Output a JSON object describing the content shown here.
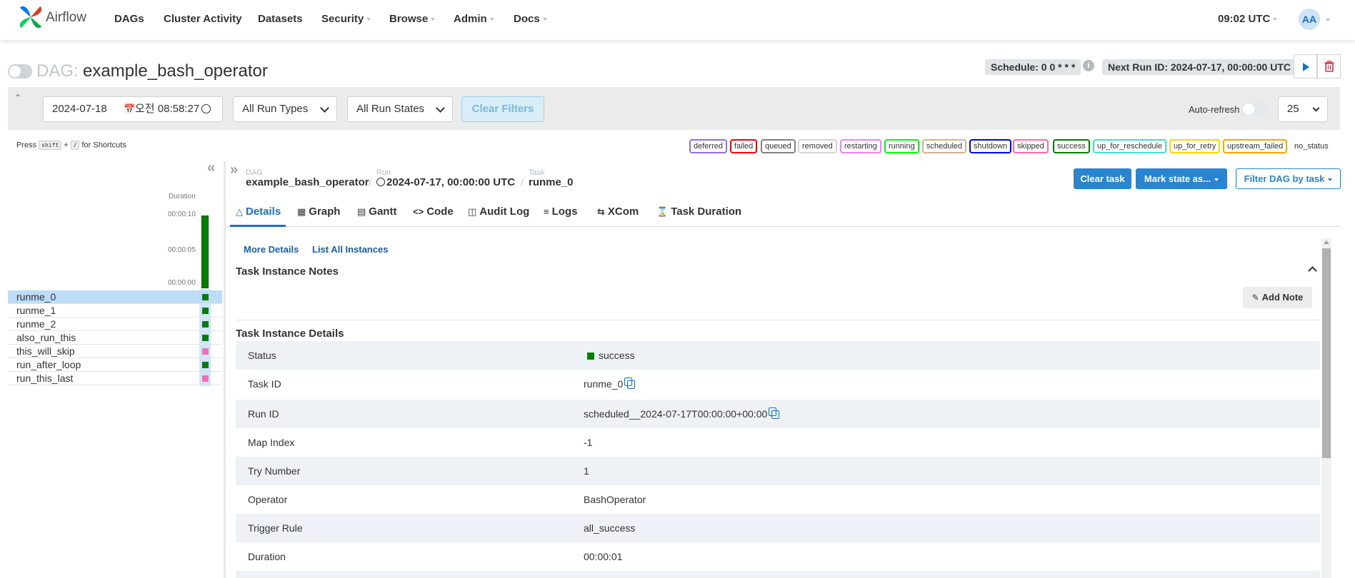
{
  "navbar": {
    "brand": "Airflow",
    "items": [
      {
        "label": "DAGs",
        "dropdown": false
      },
      {
        "label": "Cluster Activity",
        "dropdown": false
      },
      {
        "label": "Datasets",
        "dropdown": false
      },
      {
        "label": "Security",
        "dropdown": true
      },
      {
        "label": "Browse",
        "dropdown": true
      },
      {
        "label": "Admin",
        "dropdown": true
      },
      {
        "label": "Docs",
        "dropdown": true
      }
    ],
    "time": "09:02 UTC",
    "user_initials": "AA"
  },
  "dag": {
    "prefix": "DAG:",
    "name": "example_bash_operator",
    "schedule": "Schedule: 0 0 * * *",
    "next_run": "Next Run ID: 2024-07-17, 00:00:00 UTC"
  },
  "filters": {
    "date": "2024-07-18",
    "time": "오전 08:58:27",
    "run_types": "All Run Types",
    "run_states": "All Run States",
    "clear_label": "Clear Filters",
    "autorefresh_label": "Auto-refresh",
    "page_size": "25"
  },
  "shortcuts": {
    "press": "Press",
    "key1": "shift",
    "plus": "+",
    "key2": "/",
    "suffix": "for Shortcuts"
  },
  "legend": [
    {
      "label": "deferred",
      "color": "#9370db"
    },
    {
      "label": "failed",
      "color": "#ff0000"
    },
    {
      "label": "queued",
      "color": "#808080"
    },
    {
      "label": "removed",
      "color": "#d3d3d3"
    },
    {
      "label": "restarting",
      "color": "#ee82ee"
    },
    {
      "label": "running",
      "color": "#00ff00"
    },
    {
      "label": "scheduled",
      "color": "#d2b48c"
    },
    {
      "label": "shutdown",
      "color": "#0000ff"
    },
    {
      "label": "skipped",
      "color": "#ff69b4"
    },
    {
      "label": "success",
      "color": "#008000"
    },
    {
      "label": "up_for_reschedule",
      "color": "#40e0d0"
    },
    {
      "label": "up_for_retry",
      "color": "#ffd700"
    },
    {
      "label": "upstream_failed",
      "color": "#ffa500"
    },
    {
      "label": "no_status",
      "color": "#ffffff"
    }
  ],
  "grid": {
    "duration_label": "Duration",
    "ticks": [
      "00:00:10",
      "00:00:05",
      "00:00:00"
    ],
    "tasks": [
      {
        "name": "runme_0",
        "state": "success",
        "color": "#008000",
        "selected": true
      },
      {
        "name": "runme_1",
        "state": "success",
        "color": "#008000",
        "selected": false
      },
      {
        "name": "runme_2",
        "state": "success",
        "color": "#008000",
        "selected": false
      },
      {
        "name": "also_run_this",
        "state": "success",
        "color": "#008000",
        "selected": false
      },
      {
        "name": "this_will_skip",
        "state": "skipped",
        "color": "#ff69b4",
        "selected": false
      },
      {
        "name": "run_after_loop",
        "state": "success",
        "color": "#008000",
        "selected": false
      },
      {
        "name": "run_this_last",
        "state": "skipped",
        "color": "#ff69b4",
        "selected": false
      }
    ]
  },
  "breadcrumb": {
    "dag_label": "DAG",
    "dag_value": "example_bash_operator",
    "run_label": "Run",
    "run_value": "2024-07-17, 00:00:00 UTC",
    "task_label": "Task",
    "task_value": "runme_0"
  },
  "actions": {
    "clear_task": "Clear task",
    "mark_state": "Mark state as...",
    "filter_dag": "Filter DAG by task"
  },
  "tabs": [
    {
      "label": "Details",
      "icon": "warning-triangle-icon",
      "active": true
    },
    {
      "label": "Graph",
      "icon": "graph-icon",
      "active": false
    },
    {
      "label": "Gantt",
      "icon": "gantt-icon",
      "active": false
    },
    {
      "label": "Code",
      "icon": "code-icon",
      "active": false
    },
    {
      "label": "Audit Log",
      "icon": "file-icon",
      "active": false
    },
    {
      "label": "Logs",
      "icon": "list-icon",
      "active": false
    },
    {
      "label": "XCom",
      "icon": "swap-icon",
      "active": false
    },
    {
      "label": "Task Duration",
      "icon": "hourglass-icon",
      "active": false
    }
  ],
  "details": {
    "more_details": "More Details",
    "list_all_instances": "List All Instances",
    "notes_title": "Task Instance Notes",
    "add_note": "Add Note",
    "details_title": "Task Instance Details",
    "rows": [
      {
        "key": "Status",
        "value": "success"
      },
      {
        "key": "Task ID",
        "value": "runme_0"
      },
      {
        "key": "Run ID",
        "value": "scheduled__2024-07-17T00:00:00+00:00"
      },
      {
        "key": "Map Index",
        "value": "-1"
      },
      {
        "key": "Try Number",
        "value": "1"
      },
      {
        "key": "Operator",
        "value": "BashOperator"
      },
      {
        "key": "Trigger Rule",
        "value": "all_success"
      },
      {
        "key": "Duration",
        "value": "00:00:01"
      }
    ]
  },
  "colors": {
    "accent": "#1c70c3",
    "primary_button": "#2a85d0",
    "success": "#008000",
    "skipped": "#ff69b4"
  }
}
